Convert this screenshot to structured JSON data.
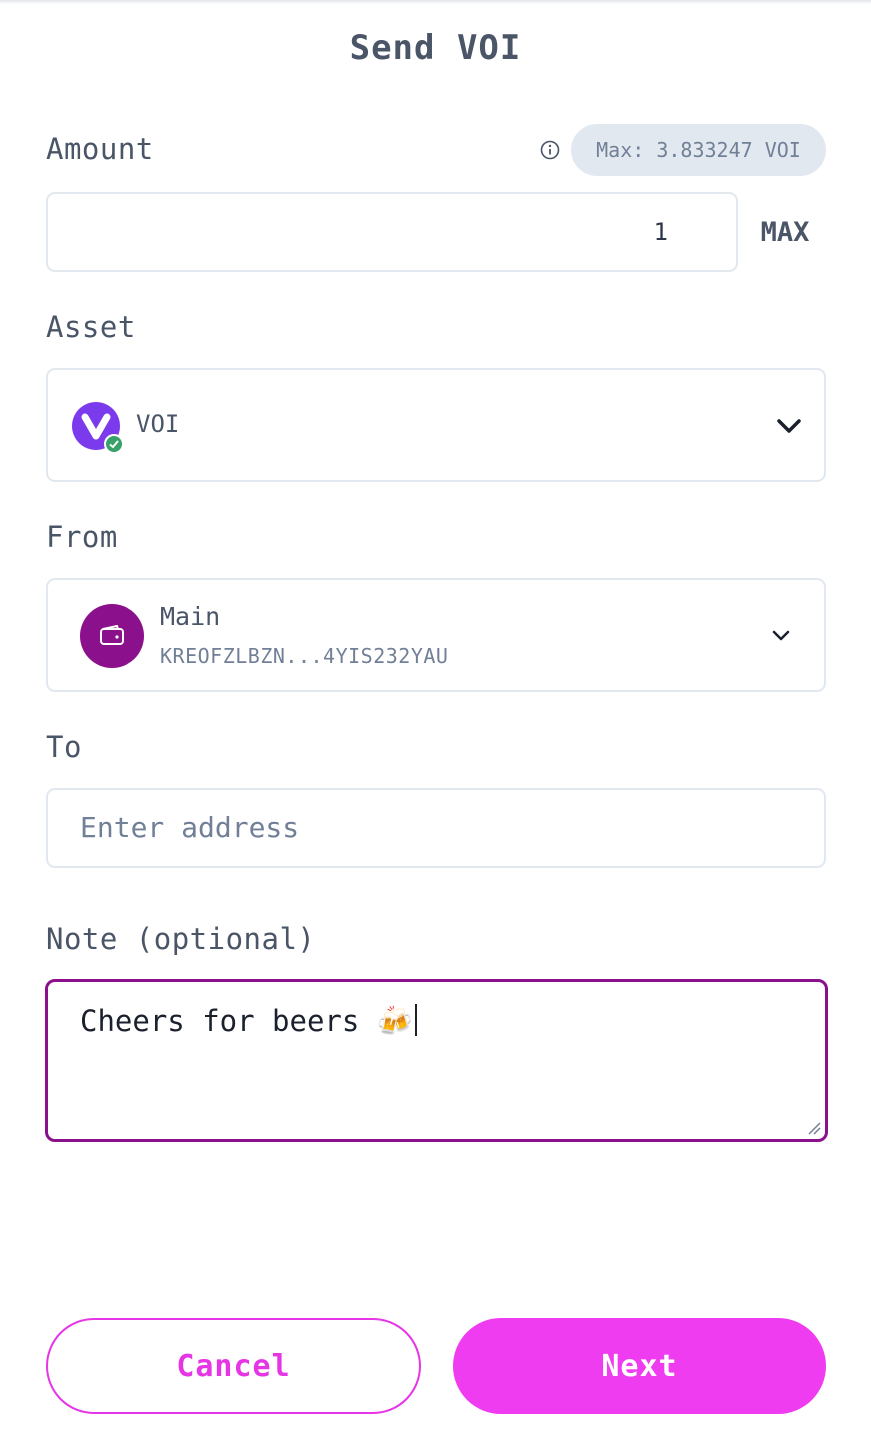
{
  "header": {
    "title": "Send VOI"
  },
  "amount": {
    "label": "Amount",
    "max_badge": "Max: 3.833247 VOI",
    "value": "1",
    "max_button": "MAX"
  },
  "asset": {
    "label": "Asset",
    "selected": "VOI"
  },
  "from": {
    "label": "From",
    "account_name": "Main",
    "account_address": "KREOFZLBZN...4YIS232YAU"
  },
  "to": {
    "label": "To",
    "placeholder": "Enter address"
  },
  "note": {
    "label": "Note (optional)",
    "value": "Cheers for beers 🍻"
  },
  "actions": {
    "cancel": "Cancel",
    "next": "Next"
  },
  "colors": {
    "accent": "#f03cf0",
    "focus_border": "#8b108b",
    "voi_purple": "#7c3aed",
    "verified_green": "#38a169"
  },
  "icons": [
    "info-icon",
    "voi-logo-icon",
    "verified-check-icon",
    "chevron-down-icon",
    "wallet-icon",
    "resize-handle-icon"
  ]
}
